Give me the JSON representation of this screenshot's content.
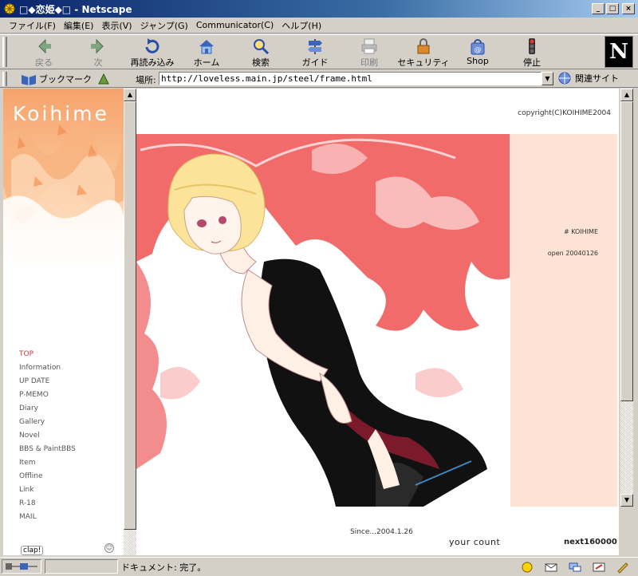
{
  "window": {
    "title": "□◆恋姫◆□ - Netscape"
  },
  "menu": [
    "ファイル(F)",
    "編集(E)",
    "表示(V)",
    "ジャンプ(G)",
    "Communicator(C)",
    "ヘルプ(H)"
  ],
  "toolbar": {
    "back": "戻る",
    "forward": "次",
    "reload": "再読み込み",
    "home": "ホーム",
    "search": "検索",
    "guide": "ガイド",
    "print": "印刷",
    "security": "セキュリティ",
    "shop": "Shop",
    "stop": "停止"
  },
  "location": {
    "bookmarks": "ブックマーク",
    "label": "場所:",
    "url": "http://loveless.main.jp/steel/frame.html",
    "related": "関連サイト"
  },
  "left": {
    "site_title": "Koihime",
    "nav": [
      "TOP",
      "Information",
      "UP DATE",
      "P-MEMO",
      "Diary",
      "Gallery",
      "Novel",
      "BBS & PaintBBS",
      "Item",
      "Offline",
      "Link",
      "R-18",
      "MAIL"
    ],
    "clap": "clap!"
  },
  "main": {
    "copyright": "copyright(C)KOIHIME2004",
    "side_title": "# KOIHIME",
    "side_open": "open 20040126",
    "since": "Since...2004.1.26",
    "your_count": "your count",
    "next": "next160000"
  },
  "status": {
    "text": "ドキュメント: 完了。"
  },
  "colors": {
    "banner": "#f4a46a",
    "side_panel": "#fde3d3",
    "art_red": "#f26b6b",
    "active_nav": "#cc3333"
  }
}
